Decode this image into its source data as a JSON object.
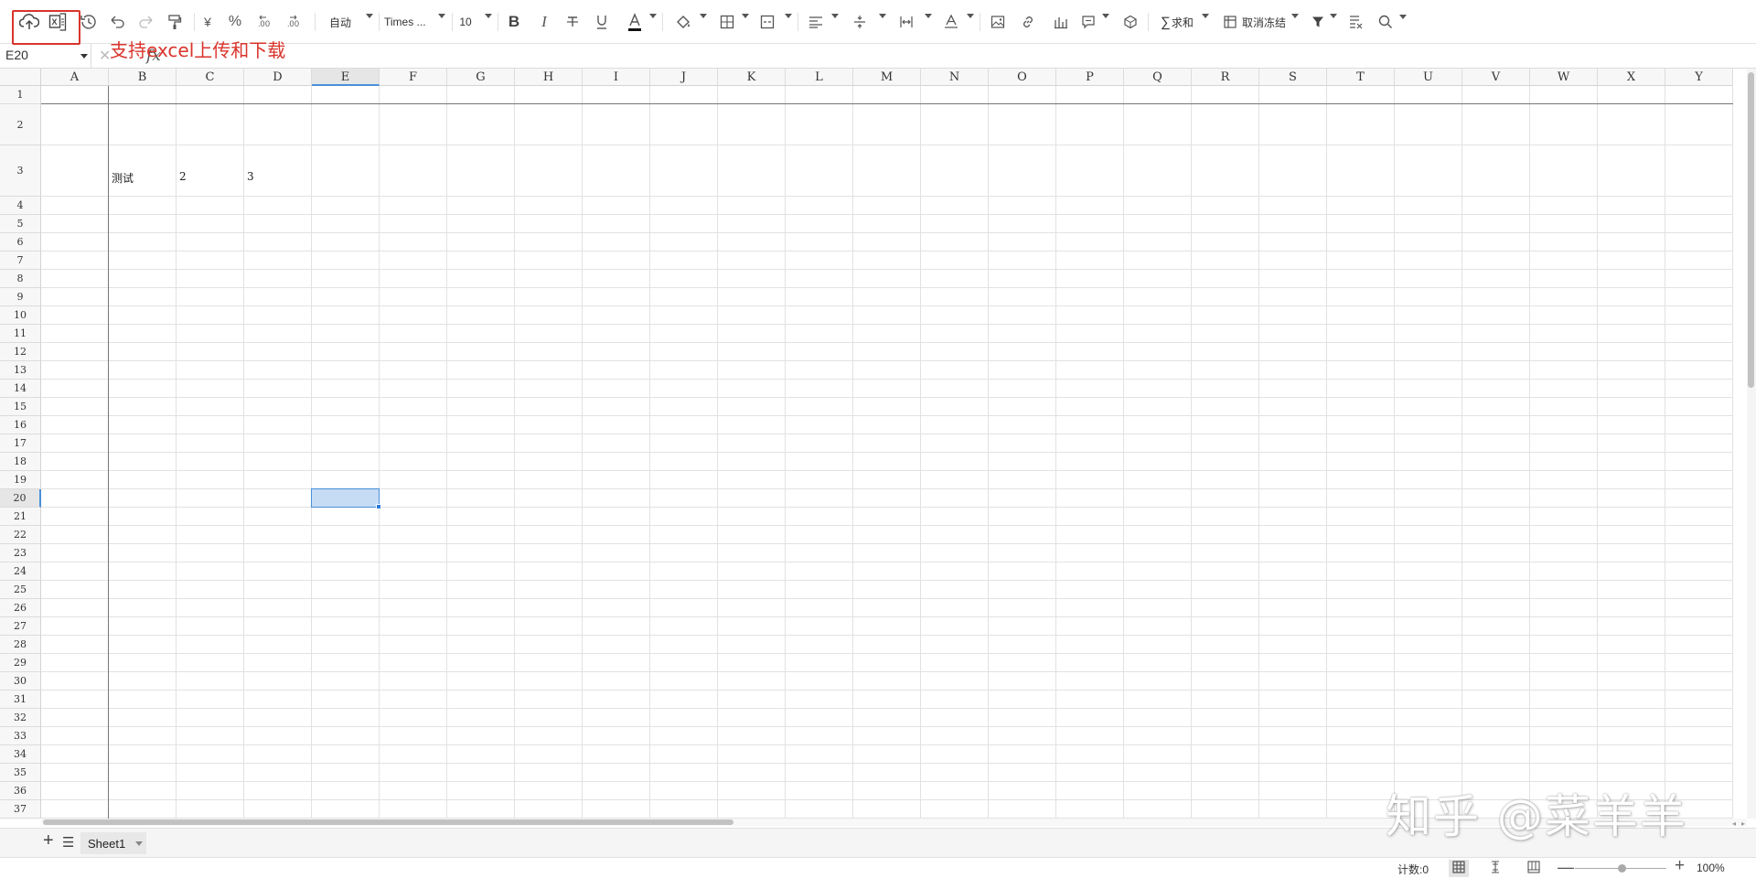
{
  "toolbar": {
    "number_format": "自动",
    "font_family": "Times ...",
    "font_size": "10",
    "sum_label": "求和",
    "freeze_label": "取消冻结"
  },
  "annotation": "支持excel上传和下载",
  "formula_bar": {
    "cell_ref": "E20",
    "cancel_glyph": "✕",
    "fx_label": "fx",
    "value": ""
  },
  "grid": {
    "columns": [
      "A",
      "B",
      "C",
      "D",
      "E",
      "F",
      "G",
      "H",
      "I",
      "J",
      "K",
      "L",
      "M",
      "N",
      "O",
      "P",
      "Q",
      "R",
      "S",
      "T",
      "U",
      "V",
      "W",
      "X",
      "Y"
    ],
    "rows": [
      "1",
      "2",
      "3",
      "4",
      "5",
      "6",
      "7",
      "8",
      "9",
      "10",
      "11",
      "12",
      "13",
      "14",
      "15",
      "16",
      "17",
      "18",
      "19",
      "20",
      "21",
      "22",
      "23",
      "24",
      "25",
      "26",
      "27",
      "28",
      "29",
      "30",
      "31",
      "32",
      "33",
      "34",
      "35",
      "36",
      "37"
    ],
    "selected_cell": "E20",
    "cells": {
      "B3": "测试",
      "C3": "2",
      "D3": "3"
    }
  },
  "sheets": {
    "tabs": [
      "Sheet1"
    ],
    "active": "Sheet1"
  },
  "status": {
    "count": "计数:0",
    "zoom": "100%"
  },
  "watermark": "知乎 @菜羊羊",
  "colors": {
    "highlight_red": "#d9342b",
    "selection_fill": "#c6dcf5",
    "selection_border": "#4a90d9"
  }
}
